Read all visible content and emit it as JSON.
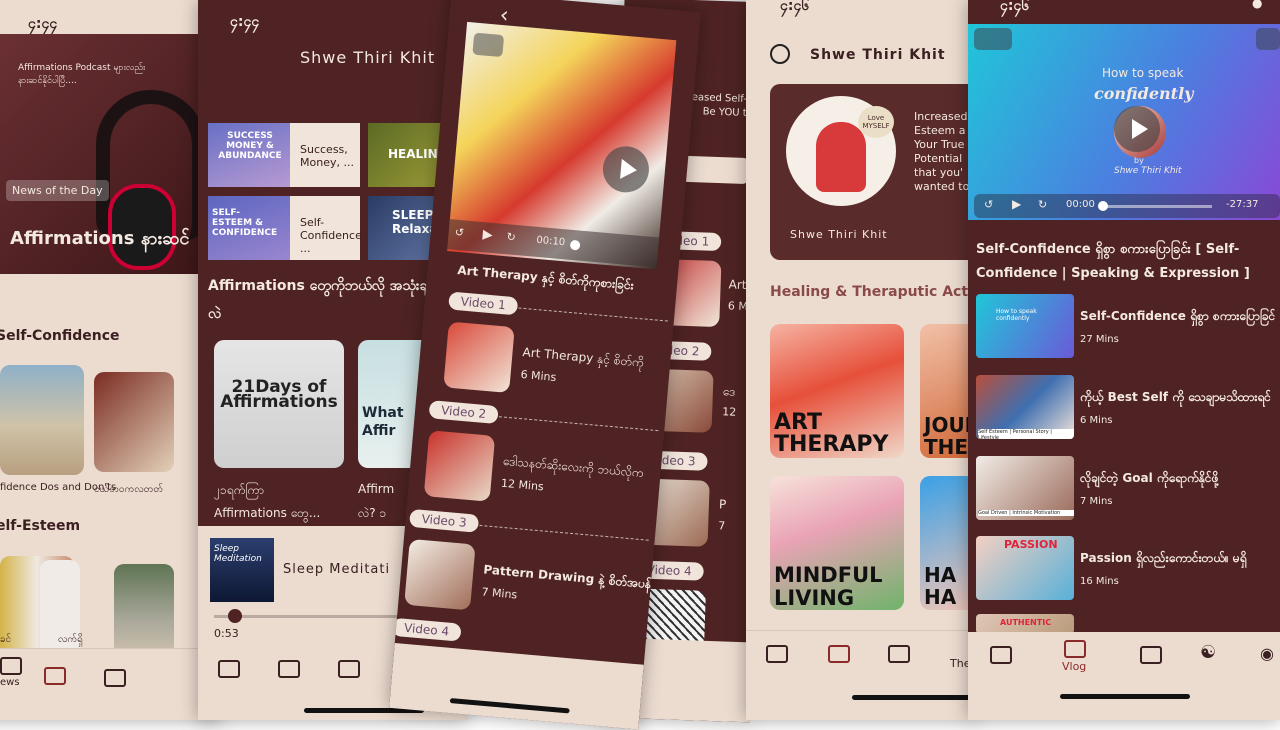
{
  "s1": {
    "time": "၄:၄၄",
    "banner_small": "Affirmations Podcast များလည်း နားဆင်နိုင်ပါပြီ....",
    "badge": "News of the Day",
    "banner_title": "Affirmations နားဆင်",
    "section1": "Self-Confidence",
    "card1_caption": "fidence Dos and Don'ts",
    "card2_caption": "ငယ်ဘဝကလတတ်",
    "section2": "elf-Esteem",
    "card3_caption": "ခင်",
    "card4_caption": "လက်ရှိ",
    "nav_news": "ews"
  },
  "s2": {
    "time": "၄:၄၄",
    "dots": "•••",
    "author": "Shwe Thiri Khit",
    "grid": [
      {
        "thumb_title": "SUCCESS MONEY & ABUNDANCE",
        "label": "Success, Money, ..."
      },
      {
        "thumb_title": "HEALING",
        "label": ""
      },
      {
        "thumb_title": "SELF-ESTEEM & CONFIDENCE",
        "label": "Self-Confidence ..."
      },
      {
        "thumb_title": "SLEEP Relaxa",
        "label": ""
      }
    ],
    "section": "Affirmations တွေကိုဘယ်လို အသုံးချမလဲ",
    "card1_title": "21Days of Affirmations",
    "card1_caption1": "၂၁ရက်ကြာ",
    "card1_caption2": "Affirmations တွေ...",
    "card2_title": "What Affir",
    "card2_caption1": "Affirm",
    "card2_caption2": "လဲ? ၁",
    "player_thumb": "Sleep Meditation",
    "player_title": "Sleep Meditati",
    "player_time": "0:53"
  },
  "s3": {
    "video_time": "00:10",
    "title": "Art Therapy နှင့် စိတ်ကိုကုစားခြင်း",
    "items": [
      {
        "pill": "Video 1",
        "title": "Art Therapy နှင့် စိတ်ကို",
        "dur": "6 Mins"
      },
      {
        "pill": "Video 2",
        "title": "ဒေါသနတ်ဆိုးလေးကို ဘယ်လိုက",
        "dur": "12 Mins"
      },
      {
        "pill": "Video 3",
        "title": "Pattern Drawing နဲ့ စိတ်အပန်းဖြေ",
        "dur": "7 Mins"
      },
      {
        "pill": "Video 4",
        "title": "",
        "dur": ""
      }
    ]
  },
  "s4": {
    "header_l1": "Increased Self-Este",
    "header_l2": "Be YOU tha",
    "items": [
      {
        "pill": "Video 1",
        "title": "Art",
        "dur": "6 M"
      },
      {
        "pill": "Video 2",
        "title": "ဒေ",
        "dur": "12"
      },
      {
        "pill": "Video 3",
        "title": "P",
        "dur": "7"
      },
      {
        "pill": "Video 4",
        "title": "",
        "dur": ""
      }
    ]
  },
  "s5": {
    "time": "၄:၄၆",
    "author": "Shwe Thiri Khit",
    "hero_badge": "Love MYSELF",
    "hero_caption": "Shwe Thiri Khit",
    "hero_text": [
      "Increased",
      "Esteem a",
      "Your True",
      "Potential",
      "that you'",
      "wanted to"
    ],
    "section": "Healing & Theraputic Act",
    "cards": [
      "ART THERAPY",
      "JOUR THE",
      "MINDFUL LIVING",
      "HA HA"
    ],
    "nav_label": "The"
  },
  "s6": {
    "time": "၄:၄၆",
    "video_title": "How to speak",
    "video_script": "confidently",
    "video_by": "by",
    "video_sign": "Shwe Thiri Khit",
    "time_cur": "00:00",
    "time_rem": "-27:37",
    "heading": "Self-Confidence ရှိစွာ စကားပြောခြင်း [ Self-Confidence | Speaking & Expression ]",
    "items": [
      {
        "title": "Self-Confidence ရှိစွာ စကားပြောခြင်",
        "dur": "27 Mins",
        "thumb": "How to speak confidently"
      },
      {
        "title": "ကိုယ့် Best Self ကို သေချာမသိထားရင်",
        "dur": "6 Mins",
        "thumb": "Self Esteem | Personal Story | Lifestyle"
      },
      {
        "title": "လိုချင်တဲ့ Goal ကိုရောက်နိုင်ဖို့",
        "dur": "7 Mins",
        "thumb": "Goal Driven | Intrinsic Motivation"
      },
      {
        "title": "Passion ရှိလည်းကောင်းတယ်။ မရှိ",
        "dur": "16 Mins",
        "thumb": "PASSION"
      },
      {
        "title": "",
        "dur": "",
        "thumb": "AUTHENTIC"
      }
    ],
    "nav_vlog": "Vlog"
  },
  "colors": {
    "maroon": "#4f2323",
    "cream": "#ecdcd0",
    "accent_blue": "#3ea0e6"
  }
}
